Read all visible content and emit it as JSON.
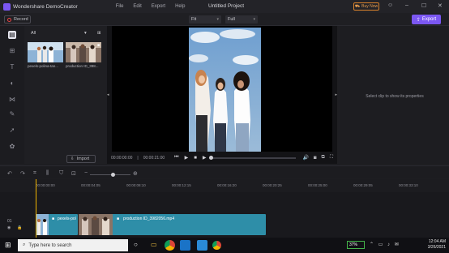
{
  "titlebar": {
    "app_name": "Wondershare DemoCreator",
    "menu": [
      "File",
      "Edit",
      "Export",
      "Help"
    ],
    "project_title": "Untitled Project",
    "buy_now": "Buy Now"
  },
  "toolbar": {
    "record_label": "Record",
    "fit_select": "Fit",
    "full_select": "Full",
    "export_label": "Export"
  },
  "media": {
    "filter_label": "All",
    "items": [
      {
        "label": "pexels-polina-tan..."
      },
      {
        "label": "production ID_398..."
      }
    ],
    "import_label": "Import"
  },
  "preview": {
    "current_time": "00:00:00:00",
    "separator": "|",
    "total_time": "00:00:21:00"
  },
  "properties": {
    "hint": "Select clip to show its properties"
  },
  "timeline": {
    "ticks": [
      "00:00:00:00",
      "00:00:04:05",
      "00:00:08:10",
      "00:00:12:15",
      "00:00:16:20",
      "00:00:20:25",
      "00:00:25:00",
      "00:00:29:05",
      "00:00:33:10"
    ],
    "track_label": "01",
    "clips": [
      {
        "label": "pexels-pol"
      },
      {
        "label": "production ID_3982056.mp4"
      }
    ]
  },
  "taskbar": {
    "search_placeholder": "Type here to search",
    "battery": "37%",
    "time": "12:04 AM",
    "date": "3/26/2021"
  },
  "colors": {
    "accent": "#7b57f2",
    "clip": "#2e8ea8",
    "playhead": "#f0b400",
    "buy_now": "#d9822b"
  }
}
